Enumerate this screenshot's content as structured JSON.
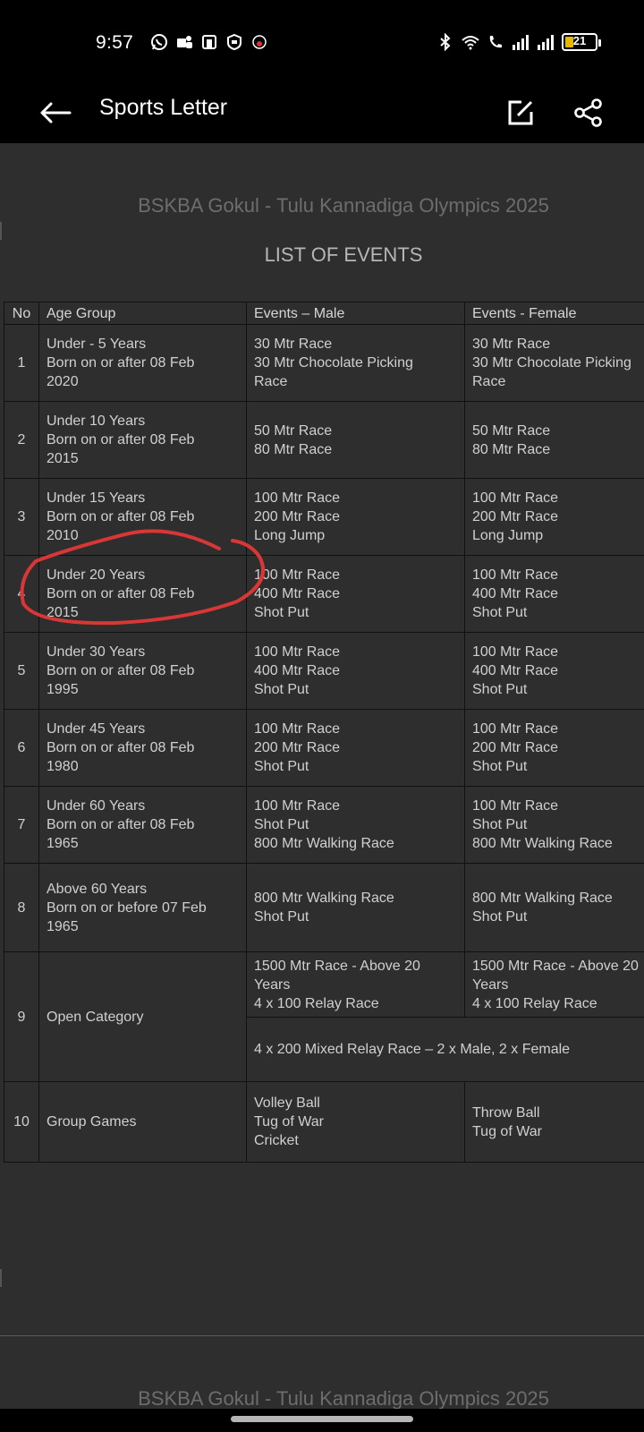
{
  "status_bar": {
    "time": "9:57",
    "left_icons": [
      "whatsapp-icon",
      "teams-icon",
      "app-icon",
      "shield-app-icon",
      "notification-dot-icon"
    ],
    "right_icons": [
      "bluetooth-icon",
      "wifi-icon",
      "call-icon",
      "signal-icon",
      "signal-icon"
    ],
    "battery_level": "21"
  },
  "app_bar": {
    "title": "Sports Letter",
    "icons": [
      "back-arrow-icon",
      "edit-icon",
      "share-icon"
    ]
  },
  "document": {
    "heading": "BSKBA Gokul - Tulu Kannadiga Olympics 2025",
    "subtitle": "LIST OF EVENTS",
    "next_page_heading": "BSKBA Gokul - Tulu Kannadiga Olympics 2025",
    "table": {
      "headers": [
        "No",
        "Age Group",
        "Events – Male",
        "Events -  Female"
      ],
      "rows": [
        {
          "no": "1",
          "age": "Under - 5 Years\nBorn on or after 08 Feb\n2020",
          "male": "30 Mtr Race\n30 Mtr Chocolate Picking\nRace",
          "female": "30 Mtr Race\n30 Mtr Chocolate Picking\nRace"
        },
        {
          "no": "2",
          "age": "Under 10 Years\nBorn on or after 08 Feb\n2015",
          "male": "50 Mtr Race\n80 Mtr Race",
          "female": "50 Mtr Race\n80 Mtr Race"
        },
        {
          "no": "3",
          "age": "Under 15 Years\nBorn on or after 08 Feb\n2010",
          "male": "100 Mtr Race\n200 Mtr Race\nLong Jump",
          "female": "100 Mtr Race\n200 Mtr Race\nLong Jump"
        },
        {
          "no": "4",
          "age": "Under 20 Years\nBorn on or after 08 Feb\n2015",
          "male": "100 Mtr Race\n400 Mtr Race\nShot Put",
          "female": "100 Mtr Race\n400 Mtr Race\nShot Put"
        },
        {
          "no": "5",
          "age": "Under 30 Years\nBorn on or after 08 Feb\n1995",
          "male": "100 Mtr Race\n400 Mtr Race\nShot Put",
          "female": "100 Mtr Race\n400 Mtr Race\nShot Put"
        },
        {
          "no": "6",
          "age": "Under 45 Years\nBorn on or after 08 Feb\n1980",
          "male": "100 Mtr Race\n200 Mtr Race\nShot Put",
          "female": "100 Mtr Race\n200 Mtr Race\nShot Put"
        },
        {
          "no": "7",
          "age": "Under 60 Years\nBorn on or after 08 Feb\n1965",
          "male": "100 Mtr Race\nShot Put\n800 Mtr Walking Race",
          "female": "100 Mtr Race\nShot Put\n800 Mtr Walking Race"
        },
        {
          "no": "8",
          "age": "Above 60 Years\nBorn on or before 07 Feb\n1965",
          "male": "800 Mtr Walking Race\nShot Put",
          "female": "800 Mtr Walking Race\nShot Put"
        }
      ],
      "open_category": {
        "no": "9",
        "age": "Open Category",
        "male": "1500 Mtr Race - Above 20\nYears\n4 x 100 Relay Race",
        "female": "1500 Mtr Race - Above 20\nYears\n4 x 100 Relay Race",
        "mixed": "4 x 200 Mixed Relay Race – 2 x Male, 2 x Female"
      },
      "group_games": {
        "no": "10",
        "age": "Group Games",
        "male": "Volley Ball\nTug of War\nCricket",
        "female": "Throw Ball\nTug of War"
      }
    }
  },
  "colors": {
    "document_bg": "#2e2e2e",
    "heading_text": "#6d6d6d",
    "annotation_stroke": "#d93636"
  }
}
